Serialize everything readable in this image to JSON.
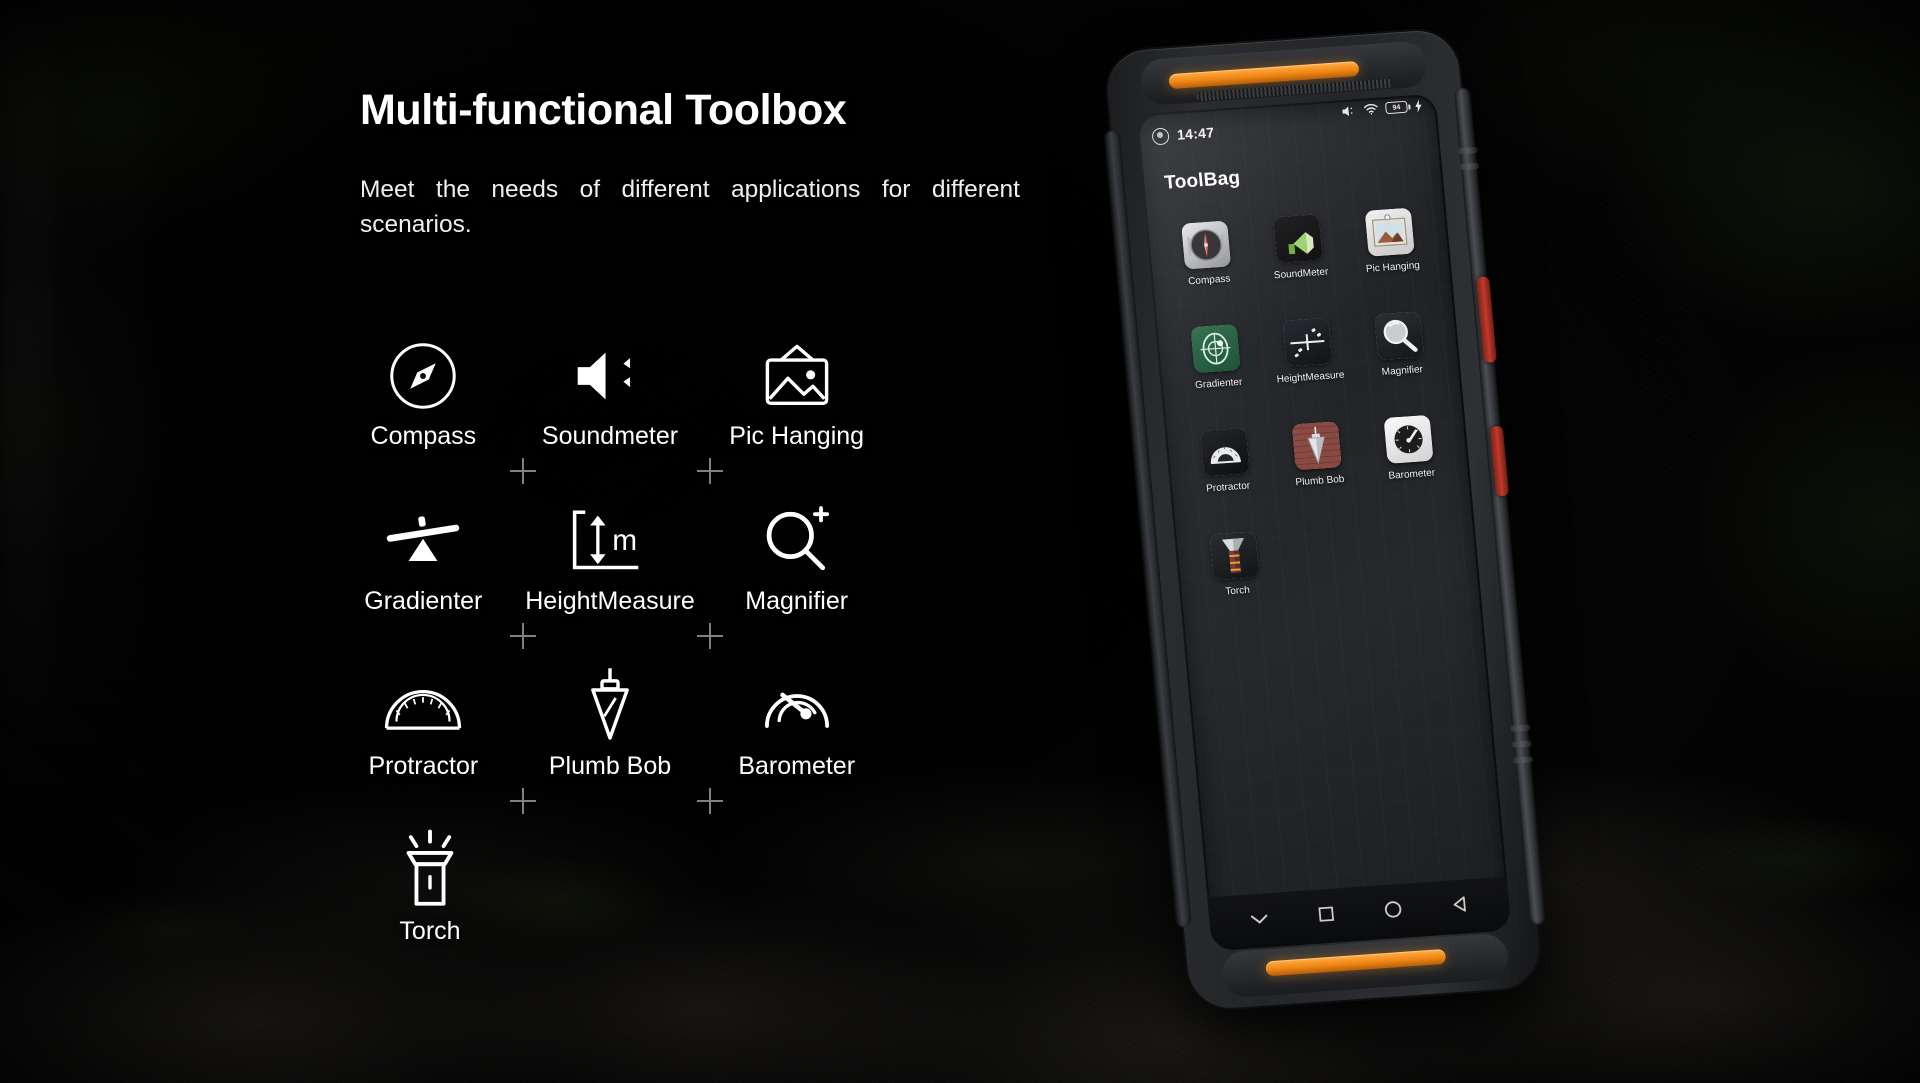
{
  "headline": "Multi-functional Toolbox",
  "subcopy": "Meet the needs of different applications for different scenarios.",
  "features": [
    {
      "label": "Compass",
      "icon": "compass-icon"
    },
    {
      "label": "Soundmeter",
      "icon": "speaker-sound-icon"
    },
    {
      "label": "Pic Hanging",
      "icon": "picture-frame-icon"
    },
    {
      "label": "Gradienter",
      "icon": "seesaw-level-icon"
    },
    {
      "label": "HeightMeasure",
      "icon": "height-ruler-icon",
      "unit": "m"
    },
    {
      "label": "Magnifier",
      "icon": "magnifier-plus-icon"
    },
    {
      "label": "Protractor",
      "icon": "protractor-icon"
    },
    {
      "label": "Plumb Bob",
      "icon": "plumb-bob-icon"
    },
    {
      "label": "Barometer",
      "icon": "gauge-icon"
    },
    {
      "label": "Torch",
      "icon": "flashlight-icon"
    }
  ],
  "phone": {
    "statusbar": {
      "time": "14:47",
      "clock_icon": "camera-punchhole-icon",
      "icons": [
        "volume-mute-icon",
        "wifi-icon",
        "battery-icon",
        "charging-icon"
      ],
      "battery_level": "94"
    },
    "app_title": "ToolBag",
    "apps": [
      {
        "label": "Compass",
        "icon": "compass-app-icon"
      },
      {
        "label": "SoundMeter",
        "icon": "soundmeter-app-icon"
      },
      {
        "label": "Pic Hanging",
        "icon": "pichanging-app-icon"
      },
      {
        "label": "Gradienter",
        "icon": "gradienter-app-icon"
      },
      {
        "label": "HeightMeasure",
        "icon": "heightmeasure-app-icon"
      },
      {
        "label": "Magnifier",
        "icon": "magnifier-app-icon"
      },
      {
        "label": "Protractor",
        "icon": "protractor-app-icon"
      },
      {
        "label": "Plumb Bob",
        "icon": "plumbbob-app-icon"
      },
      {
        "label": "Barometer",
        "icon": "barometer-app-icon"
      },
      {
        "label": "Torch",
        "icon": "torch-app-icon"
      }
    ],
    "navbar": [
      "chevron-down-icon",
      "recents-square-icon",
      "home-circle-icon",
      "back-triangle-icon"
    ]
  },
  "colors": {
    "accent_orange": "#ef8514",
    "side_button_red": "#c2392a",
    "text_white": "#ffffff",
    "background": "#000000"
  }
}
